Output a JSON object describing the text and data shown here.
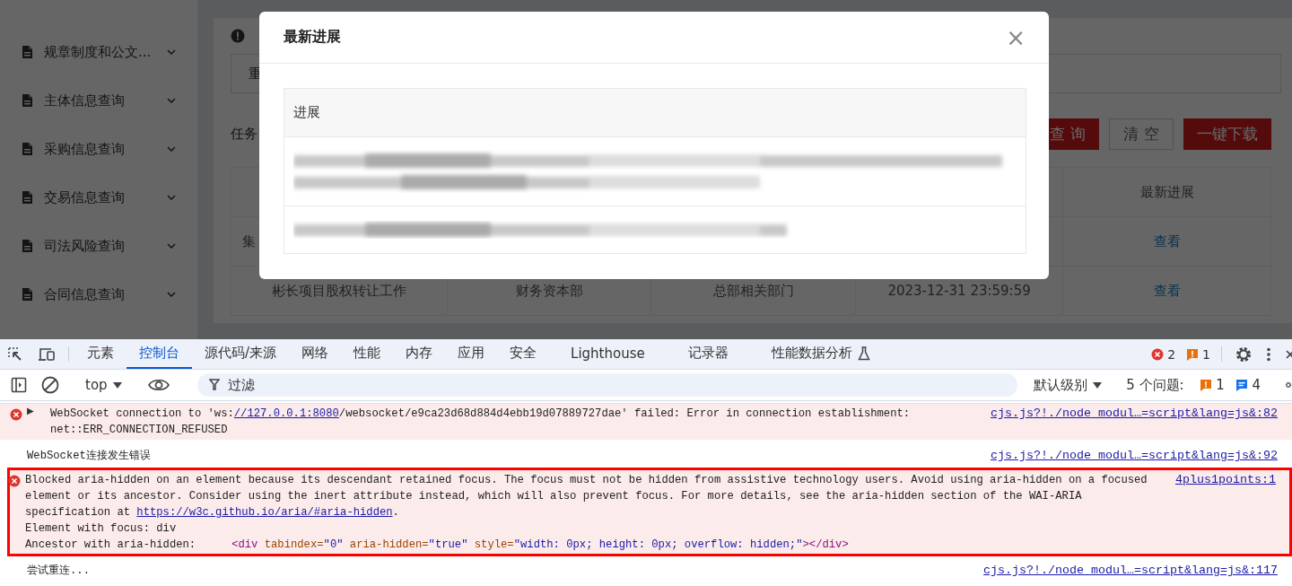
{
  "sidebar": {
    "items": [
      {
        "label": "规章制度和公文...",
        "kind": "menu"
      },
      {
        "label": "主体信息查询",
        "kind": "menu"
      },
      {
        "label": "采购信息查询",
        "kind": "menu"
      },
      {
        "label": "交易信息查询",
        "kind": "menu"
      },
      {
        "label": "司法风险查询",
        "kind": "menu"
      },
      {
        "label": "合同信息查询",
        "kind": "menu"
      }
    ]
  },
  "page": {
    "tab": "重",
    "filter_label": "任务",
    "buttons": [
      {
        "label": "查 询",
        "kind": "primary"
      },
      {
        "label": "清 空",
        "kind": "plain"
      },
      {
        "label": "一键下载",
        "kind": "primary"
      }
    ],
    "table": {
      "columns": [
        "",
        "",
        "",
        "",
        "最新进展"
      ],
      "rows": [
        [
          "集",
          "",
          "",
          "",
          "查看"
        ],
        [
          "彬长项目股权转让工作",
          "财务资本部",
          "总部相关部门",
          "2023-12-31 23:59:59",
          "查看"
        ]
      ]
    }
  },
  "modal": {
    "title": "最新进展",
    "close": "×",
    "column": "进展",
    "rows": [
      {
        "kind": "blurred-two-lines"
      },
      {
        "kind": "blurred-one-line"
      }
    ]
  },
  "devtools": {
    "tabs": [
      {
        "label": "元素",
        "selected": false
      },
      {
        "label": "控制台",
        "selected": true
      },
      {
        "label": "源代码/来源",
        "selected": false
      },
      {
        "label": "网络",
        "selected": false
      },
      {
        "label": "性能",
        "selected": false
      },
      {
        "label": "内存",
        "selected": false
      },
      {
        "label": "应用",
        "selected": false
      },
      {
        "label": "安全",
        "selected": false
      },
      {
        "label": "Lighthouse",
        "selected": false
      },
      {
        "label": "记录器",
        "selected": false
      },
      {
        "label": "性能数据分析",
        "selected": false
      }
    ],
    "error_count": "2",
    "warning_count": "1",
    "context": "top",
    "filter_placeholder": "过滤",
    "level": "默认级别",
    "issues_label": "5 个问题:",
    "issue_warnings": "1",
    "issue_infos": "4",
    "messages": [
      {
        "kind": "error",
        "expand": "▶",
        "parts": [
          {
            "kind": "text",
            "text": "WebSocket connection to 'ws:"
          },
          {
            "kind": "link",
            "text": "//127.0.0.1:8080"
          },
          {
            "kind": "text",
            "text": "/websocket/e9ca23d68d884d4ebb19d07889727dae' failed: Error in connection establishment: net::ERR_CONNECTION_REFUSED"
          }
        ],
        "source": "cjs.js?!./node_modul…=script&lang=js&:82",
        "highlighted": false
      },
      {
        "kind": "log",
        "parts": [
          {
            "kind": "text",
            "text": "WebSocket连接发生错误"
          }
        ],
        "source": "cjs.js?!./node_modul…=script&lang=js&:92",
        "highlighted": false
      },
      {
        "kind": "error",
        "parts": [
          {
            "kind": "text",
            "text": "Blocked aria-hidden on an element because its descendant retained focus. The focus must not be hidden from assistive technology users. Avoid using aria-hidden on a focused element or its ancestor. Consider using the inert attribute instead, which will also prevent focus. For more details, see the aria-hidden section of the WAI-ARIA specification at "
          },
          {
            "kind": "link",
            "text": "https://w3c.github.io/aria/#aria-hidden"
          },
          {
            "kind": "text",
            "text": "."
          }
        ],
        "source": "4plus1points:1",
        "highlighted": true,
        "extra": [
          "Element with focus: div"
        ],
        "ancestor_label": "Ancestor with aria-hidden:",
        "snippet": [
          {
            "kind": "tag",
            "text": "<div"
          },
          {
            "kind": "attr",
            "text": " tabindex="
          },
          {
            "kind": "value",
            "text": "\"0\""
          },
          {
            "kind": "attr",
            "text": " aria-hidden="
          },
          {
            "kind": "value",
            "text": "\"true\""
          },
          {
            "kind": "attr",
            "text": " style="
          },
          {
            "kind": "value",
            "text": "\"width: 0px; height: 0px; overflow: hidden;\""
          },
          {
            "kind": "tag",
            "text": "></div>"
          }
        ]
      },
      {
        "kind": "log",
        "parts": [
          {
            "kind": "text",
            "text": "尝试重连..."
          }
        ],
        "source": "cjs.js?!./node_modul…=script&lang=js&:117",
        "highlighted": false
      }
    ]
  }
}
